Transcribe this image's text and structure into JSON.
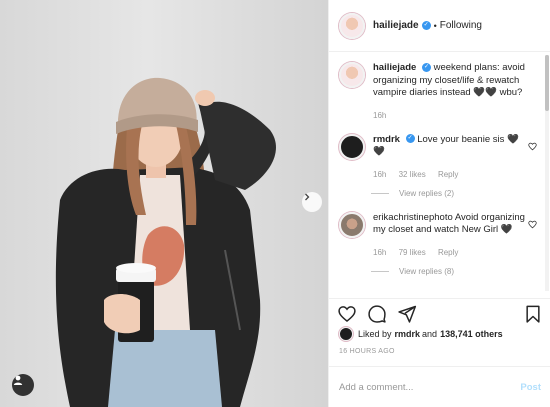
{
  "header": {
    "username": "hailiejade",
    "separator": "•",
    "follow_state": "Following"
  },
  "caption": {
    "username": "hailiejade",
    "text": "weekend plans: avoid organizing my closet/life & rewatch vampire diaries instead 🖤🖤 wbu?",
    "time": "16h"
  },
  "comments": [
    {
      "username": "rmdrk",
      "verified": true,
      "text": "Love your beanie sis 🖤 🖤",
      "time": "16h",
      "likes": "32 likes",
      "reply": "Reply",
      "view_replies": "View replies (2)"
    },
    {
      "username": "erikachristinephoto",
      "verified": false,
      "text": "Avoid organizing my closet and watch New Girl 🖤",
      "time": "16h",
      "likes": "79 likes",
      "reply": "Reply",
      "view_replies": "View replies (8)"
    }
  ],
  "likes": {
    "prefix": "Liked by ",
    "user": "rmdrk",
    "middle": " and ",
    "count": "138,741 others"
  },
  "timestamp": "16 HOURS AGO",
  "add_comment": {
    "placeholder": "Add a comment...",
    "post_label": "Post"
  },
  "icons": {
    "verified": "verified-badge-icon",
    "heart": "heart-icon",
    "comment": "comment-icon",
    "share": "share-icon",
    "bookmark": "bookmark-icon",
    "next": "chevron-right-icon",
    "tag": "user-tag-icon"
  },
  "colors": {
    "verified_blue": "#3897f0",
    "post_disabled": "#b2dffc",
    "meta_gray": "#999999"
  }
}
